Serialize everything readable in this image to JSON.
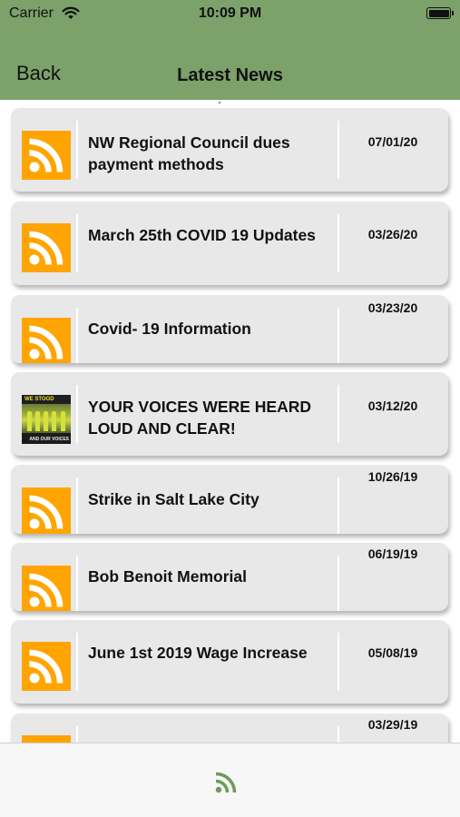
{
  "status_bar": {
    "carrier": "Carrier",
    "time": "10:09 PM"
  },
  "nav": {
    "back_label": "Back",
    "title": "Latest News"
  },
  "news": [
    {
      "title": "NW Regional Council dues payment methods",
      "date": "07/01/20",
      "icon": "rss-icon"
    },
    {
      "title": "March 25th COVID 19 Updates",
      "date": "03/26/20",
      "icon": "rss-icon"
    },
    {
      "title": "Covid- 19 Information",
      "date": "03/23/20",
      "icon": "rss-icon"
    },
    {
      "title": "YOUR VOICES WERE HEARD LOUD AND CLEAR!",
      "date": "03/12/20",
      "icon": "news-photo",
      "photo_top_text": "WE STOOD",
      "photo_bottom_text": "AND OUR VOICES"
    },
    {
      "title": "Strike in Salt Lake City",
      "date": "10/26/19",
      "icon": "rss-icon"
    },
    {
      "title": "Bob Benoit Memorial",
      "date": "06/19/19",
      "icon": "rss-icon"
    },
    {
      "title": "June 1st 2019 Wage Increase",
      "date": "05/08/19",
      "icon": "rss-icon"
    },
    {
      "title": "",
      "date": "03/29/19",
      "icon": "rss-icon"
    }
  ],
  "tab_bar": {
    "icon": "rss-tab-icon"
  },
  "colors": {
    "header": "#7ca16a",
    "rss_tile": "#ffa400",
    "card": "#e8e8e8",
    "tab_icon": "#6f9a5a"
  }
}
